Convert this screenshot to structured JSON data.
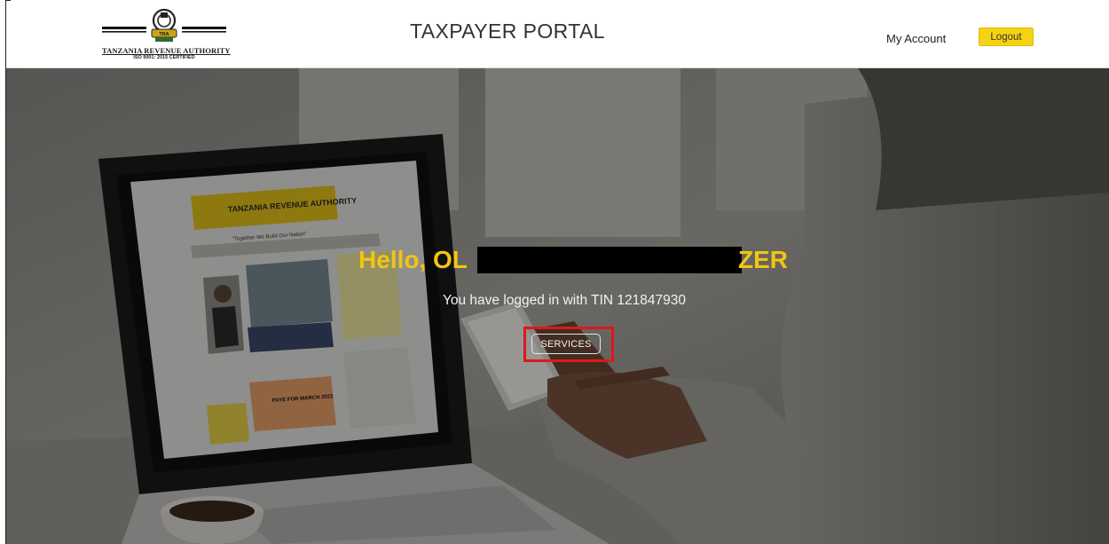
{
  "header": {
    "logo_title": "TANZANIA REVENUE AUTHORITY",
    "logo_subtitle": "ISO 9001: 2015 CERTIFIED",
    "portal_title": "TAXPAYER PORTAL",
    "my_account": "My Account",
    "logout": "Logout"
  },
  "hero": {
    "greeting_visible_start": "Hello, OL",
    "greeting_visible_end": "ZER",
    "tin_message": "You have logged in with TIN 121847930",
    "services_button": "SERVICES"
  },
  "laptop_screen": {
    "site_title": "TANZANIA REVENUE AUTHORITY",
    "slogan": "\"Together We Build Our Nation\"",
    "banner": "PAYE FOR MARCH 2022"
  },
  "colors": {
    "accent_yellow": "#f2c511",
    "logout_button": "#f5d312",
    "highlight_red": "#e0161b"
  }
}
